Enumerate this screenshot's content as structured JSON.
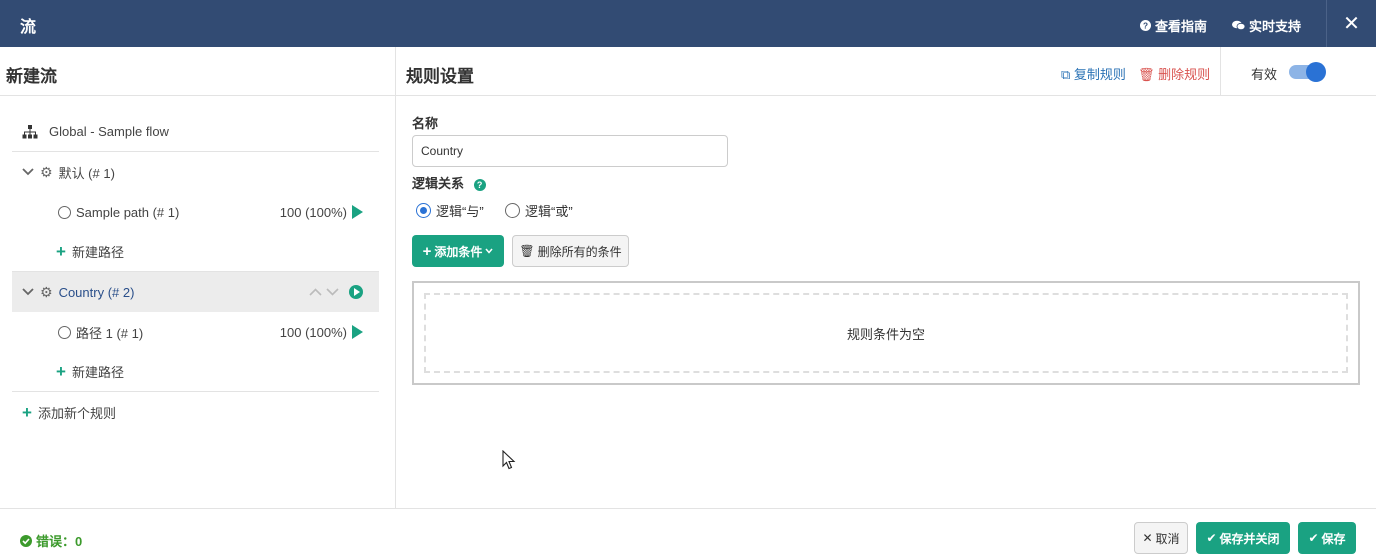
{
  "header": {
    "title": "流",
    "guide_label": "查看指南",
    "support_label": "实时支持",
    "close_label": "✕"
  },
  "left": {
    "title": "新建流",
    "global_flow": "Global - Sample flow",
    "rules": [
      {
        "label": "默认 (# 1)",
        "paths": [
          {
            "label": "Sample path (# 1)",
            "value": "100 (100%)"
          }
        ],
        "new_path": "新建路径"
      },
      {
        "label": "Country (# 2)",
        "paths": [
          {
            "label": "路径 1 (# 1)",
            "value": "100 (100%)"
          }
        ],
        "new_path": "新建路径"
      }
    ],
    "add_rule": "添加新个规则"
  },
  "right": {
    "title": "规则设置",
    "copy_rule": "复制规则",
    "delete_rule": "删除规则",
    "valid_label": "有效",
    "valid_on": true,
    "name_label": "名称",
    "name_value": "Country",
    "logic_label": "逻辑关系",
    "logic_and": "逻辑“与”",
    "logic_or": "逻辑“或”",
    "logic_selected": "and",
    "add_condition": "添加条件",
    "delete_all": "删除所有的条件",
    "empty_text": "规则条件为空"
  },
  "footer": {
    "errors": "错误：0",
    "cancel": "取消",
    "save_close": "保存并关闭",
    "save": "保存"
  },
  "colors": {
    "topbar": "#324b73",
    "accent": "#1aa282",
    "link": "#2a72b5",
    "danger": "#d9534f",
    "success_text": "#3c9a2c"
  }
}
